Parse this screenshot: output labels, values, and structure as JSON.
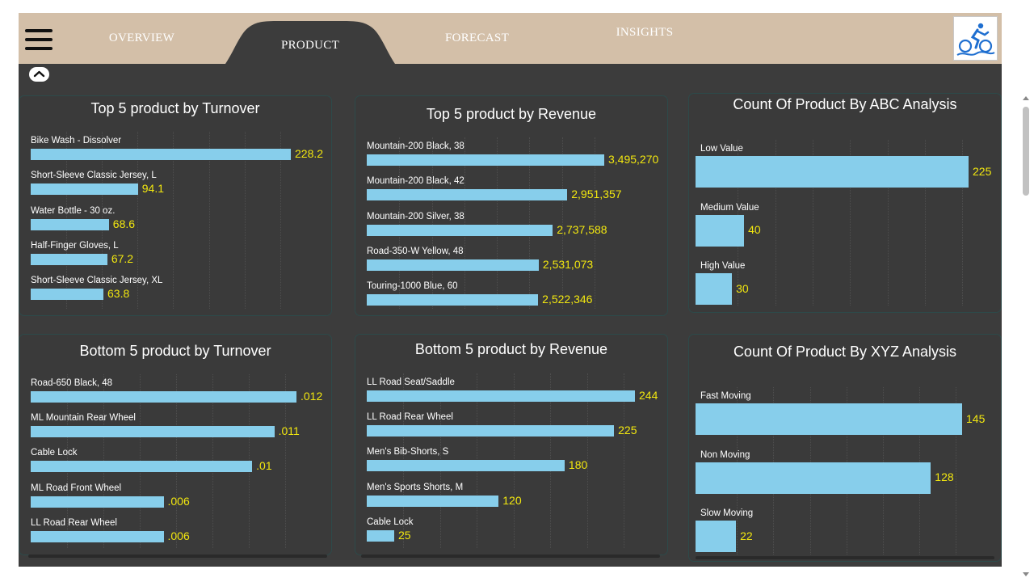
{
  "tabs": [
    {
      "label": "OVERVIEW"
    },
    {
      "label": "PRODUCT",
      "active": true
    },
    {
      "label": "FORECAST"
    },
    {
      "label": "INSIGHTS"
    }
  ],
  "colors": {
    "header": "#d3bfa8",
    "background": "#3c3c3c",
    "bar": "#87ceeb",
    "value_label": "#f2e70f",
    "title": "#ffffff"
  },
  "icons": {
    "menu": "hamburger-icon",
    "logo": "cyclist-logo",
    "collapse": "chevron-up-icon"
  },
  "charts": [
    {
      "title": "Top 5 product by Turnover",
      "bars": [
        {
          "label": "Bike Wash - Dissolver",
          "value": 228.2,
          "display": "228.2"
        },
        {
          "label": "Short-Sleeve Classic Jersey, L",
          "value": 94.1,
          "display": "94.1"
        },
        {
          "label": "Water Bottle - 30 oz.",
          "value": 68.6,
          "display": "68.6"
        },
        {
          "label": "Half-Finger Gloves, L",
          "value": 67.2,
          "display": "67.2"
        },
        {
          "label": "Short-Sleeve Classic Jersey, XL",
          "value": 63.8,
          "display": "63.8"
        }
      ]
    },
    {
      "title": "Top 5 product by Revenue",
      "bars": [
        {
          "label": "Mountain-200 Black, 38",
          "value": 3495270,
          "display": "3,495,270"
        },
        {
          "label": "Mountain-200 Black, 42",
          "value": 2951357,
          "display": "2,951,357"
        },
        {
          "label": "Mountain-200 Silver, 38",
          "value": 2737588,
          "display": "2,737,588"
        },
        {
          "label": "Road-350-W Yellow, 48",
          "value": 2531073,
          "display": "2,531,073"
        },
        {
          "label": "Touring-1000 Blue, 60",
          "value": 2522346,
          "display": "2,522,346"
        }
      ]
    },
    {
      "title": "Count Of Product By ABC Analysis",
      "bars": [
        {
          "label": "Low Value",
          "value": 225,
          "display": "225"
        },
        {
          "label": "Medium Value",
          "value": 40,
          "display": "40"
        },
        {
          "label": "High Value",
          "value": 30,
          "display": "30"
        }
      ]
    },
    {
      "title": "Bottom 5 product by Turnover",
      "bars": [
        {
          "label": "Road-650 Black, 48",
          "value": 0.012,
          "display": ".012"
        },
        {
          "label": "ML Mountain Rear Wheel",
          "value": 0.011,
          "display": ".011"
        },
        {
          "label": "Cable Lock",
          "value": 0.01,
          "display": ".01"
        },
        {
          "label": "ML Road Front Wheel",
          "value": 0.006,
          "display": ".006"
        },
        {
          "label": "LL Road Rear Wheel",
          "value": 0.006,
          "display": ".006"
        }
      ]
    },
    {
      "title": "Bottom 5 product by Revenue",
      "bars": [
        {
          "label": "LL Road Seat/Saddle",
          "value": 244,
          "display": "244"
        },
        {
          "label": "LL Road Rear Wheel",
          "value": 225,
          "display": "225"
        },
        {
          "label": "Men's Bib-Shorts, S",
          "value": 180,
          "display": "180"
        },
        {
          "label": "Men's Sports Shorts, M",
          "value": 120,
          "display": "120"
        },
        {
          "label": "Cable Lock",
          "value": 25,
          "display": "25"
        }
      ]
    },
    {
      "title": "Count Of Product By XYZ Analysis",
      "bars": [
        {
          "label": "Fast Moving",
          "value": 145,
          "display": "145"
        },
        {
          "label": "Non Moving",
          "value": 128,
          "display": "128"
        },
        {
          "label": "Slow Moving",
          "value": 22,
          "display": "22"
        }
      ]
    }
  ]
}
